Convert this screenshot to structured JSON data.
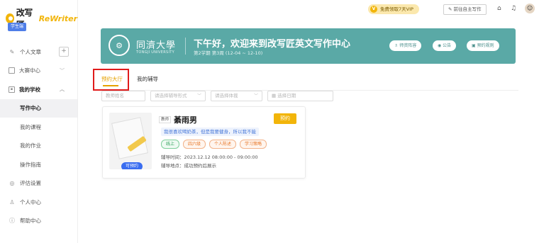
{
  "brand": {
    "cn": "改写匠",
    "en": "ReWriter"
  },
  "user_tag": "学生端",
  "sidebar": {
    "items": [
      {
        "label": "个人文章",
        "icon": "pen-icon"
      },
      {
        "label": "大赛中心",
        "icon": "trophy-icon"
      },
      {
        "label": "我的学校",
        "icon": "school-icon"
      },
      {
        "label": "写作中心"
      },
      {
        "label": "我的课程"
      },
      {
        "label": "我的作业"
      },
      {
        "label": "操作指南"
      },
      {
        "label": "评估设置",
        "icon": "settings-icon"
      },
      {
        "label": "个人中心",
        "icon": "user-icon"
      },
      {
        "label": "帮助中心",
        "icon": "help-icon"
      }
    ]
  },
  "topbar": {
    "vip_label": "免费领取7天VIP",
    "write_label": "前往自主写作"
  },
  "banner": {
    "university_cn": "同濟大學",
    "university_en": "TONGJI UNIVERSITY",
    "greeting": "下午好，欢迎来到改写匠英文写作中心",
    "week_info": "第2学期 第3周 (12-04 ~ 12-10)",
    "buttons": [
      "师资阵容",
      "公告",
      "预约规则"
    ]
  },
  "tabs": [
    "预约大厅",
    "我的辅导"
  ],
  "filters": {
    "teacher_placeholder": "教师姓名",
    "mode_placeholder": "请选择辅导形式",
    "category_placeholder": "请选择体裁",
    "date_placeholder": "选择日期"
  },
  "card": {
    "badge": "可预约",
    "teacher_label": "教师",
    "teacher_name": "綦雨男",
    "book_label": "预约",
    "intro": "我很喜欢喝奶茶，但是我要健身，所以我不能",
    "tags": [
      "线上",
      "四六级",
      "个人陈述",
      "学习策略"
    ],
    "time_label": "辅导时间：",
    "time_value": "2023.12.12 08:00:00 - 09:00:00",
    "place_label": "辅导地点：",
    "place_value": "成功预约后展示"
  },
  "colors": {
    "accent": "#f2b50a",
    "banner": "#5aa9a6",
    "highlight": "#e01b1b",
    "active_tab": "#e6a100"
  }
}
